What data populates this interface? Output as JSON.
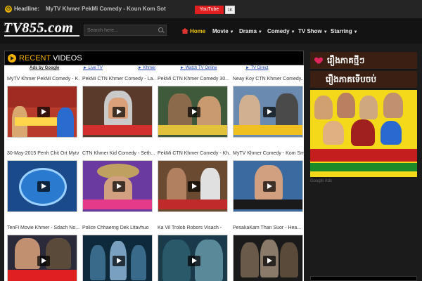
{
  "topbar": {
    "headline_label": "Headline:",
    "headline_text": "MyTV Khmer PekMi Comedy - Koun Kom Sot",
    "youtube_label": "YouTube",
    "youtube_count": "1K"
  },
  "header": {
    "logo": "TV855.com",
    "search_placeholder": "Search here...",
    "nav": [
      {
        "label": "Home"
      },
      {
        "label": "Movie"
      },
      {
        "label": "Drama"
      },
      {
        "label": "Comedy"
      },
      {
        "label": "TV Show"
      },
      {
        "label": "Starring"
      }
    ]
  },
  "main": {
    "section_title_accent": "RECENT",
    "section_title_rest": " VIDEOS",
    "ad_links": {
      "ads_by": "Ads by Google",
      "links": [
        "► Live TV",
        "► Khmer",
        "► Watch TV Online",
        "► TV Direct"
      ]
    },
    "videos": [
      {
        "title": "MyTV Khmer PekMi Comedy - K..."
      },
      {
        "title": "PekMi CTN Khmer Comedy - La..."
      },
      {
        "title": "PekMi CTN Khmer Comedy 30..."
      },
      {
        "title": "Neay Koy CTN Khmer Comedy..."
      },
      {
        "title": "30-May-2015 Penh Chit Ort Mytv"
      },
      {
        "title": "CTN Khmer Kid Comedy - Seth..."
      },
      {
        "title": "PekMi CTN Khmer Comedy - Kh..."
      },
      {
        "title": "MyTV Khmer Comedy - Kom Sm..."
      },
      {
        "title": "TenFi Movie Khmer - Sdach No..."
      },
      {
        "title": "Police Chhaerng Dek Litavhuo"
      },
      {
        "title": "Ka Vil Trolob Robors Visach -"
      },
      {
        "title": "PesakaKam Than Suor - Hea..."
      }
    ]
  },
  "sidebar": {
    "banner1": "រឿងភាគថ្មីៗ",
    "banner2": "រឿងភាគទើបចប់",
    "google_ads": "Google Ads"
  },
  "colors": {
    "accent": "#f2b200",
    "youtube_red": "#e02020",
    "link_blue": "#1a3fb0"
  }
}
